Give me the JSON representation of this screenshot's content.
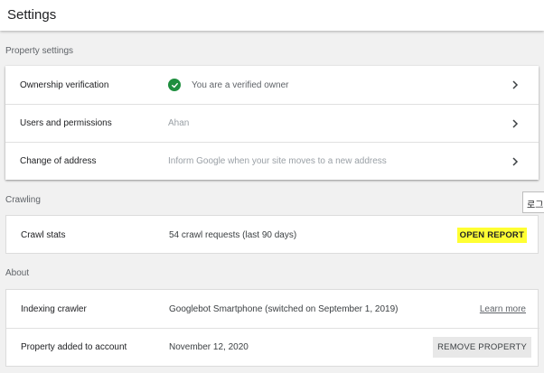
{
  "header": {
    "title": "Settings"
  },
  "property_settings": {
    "section_label": "Property settings",
    "rows": [
      {
        "label": "Ownership verification",
        "value": "You are a verified owner",
        "icon": "check-circle-icon"
      },
      {
        "label": "Users and permissions",
        "value": "Ahan"
      },
      {
        "label": "Change of address",
        "value": "Inform Google when your site moves to a new address"
      }
    ]
  },
  "crawling": {
    "section_label": "Crawling",
    "row": {
      "label": "Crawl stats",
      "value": "54 crawl requests (last 90 days)",
      "action": "OPEN REPORT"
    }
  },
  "about": {
    "section_label": "About",
    "rows": [
      {
        "label": "Indexing crawler",
        "value": "Googlebot Smartphone (switched on September 1, 2019)",
        "action": "Learn more"
      },
      {
        "label": "Property added to account",
        "value": "November 12, 2020",
        "action": "REMOVE PROPERTY"
      }
    ]
  },
  "tooltip": {
    "text": "로그"
  },
  "colors": {
    "verified": "#1e8e3e",
    "highlight": "#ffff33",
    "background": "#f1f1f1"
  }
}
